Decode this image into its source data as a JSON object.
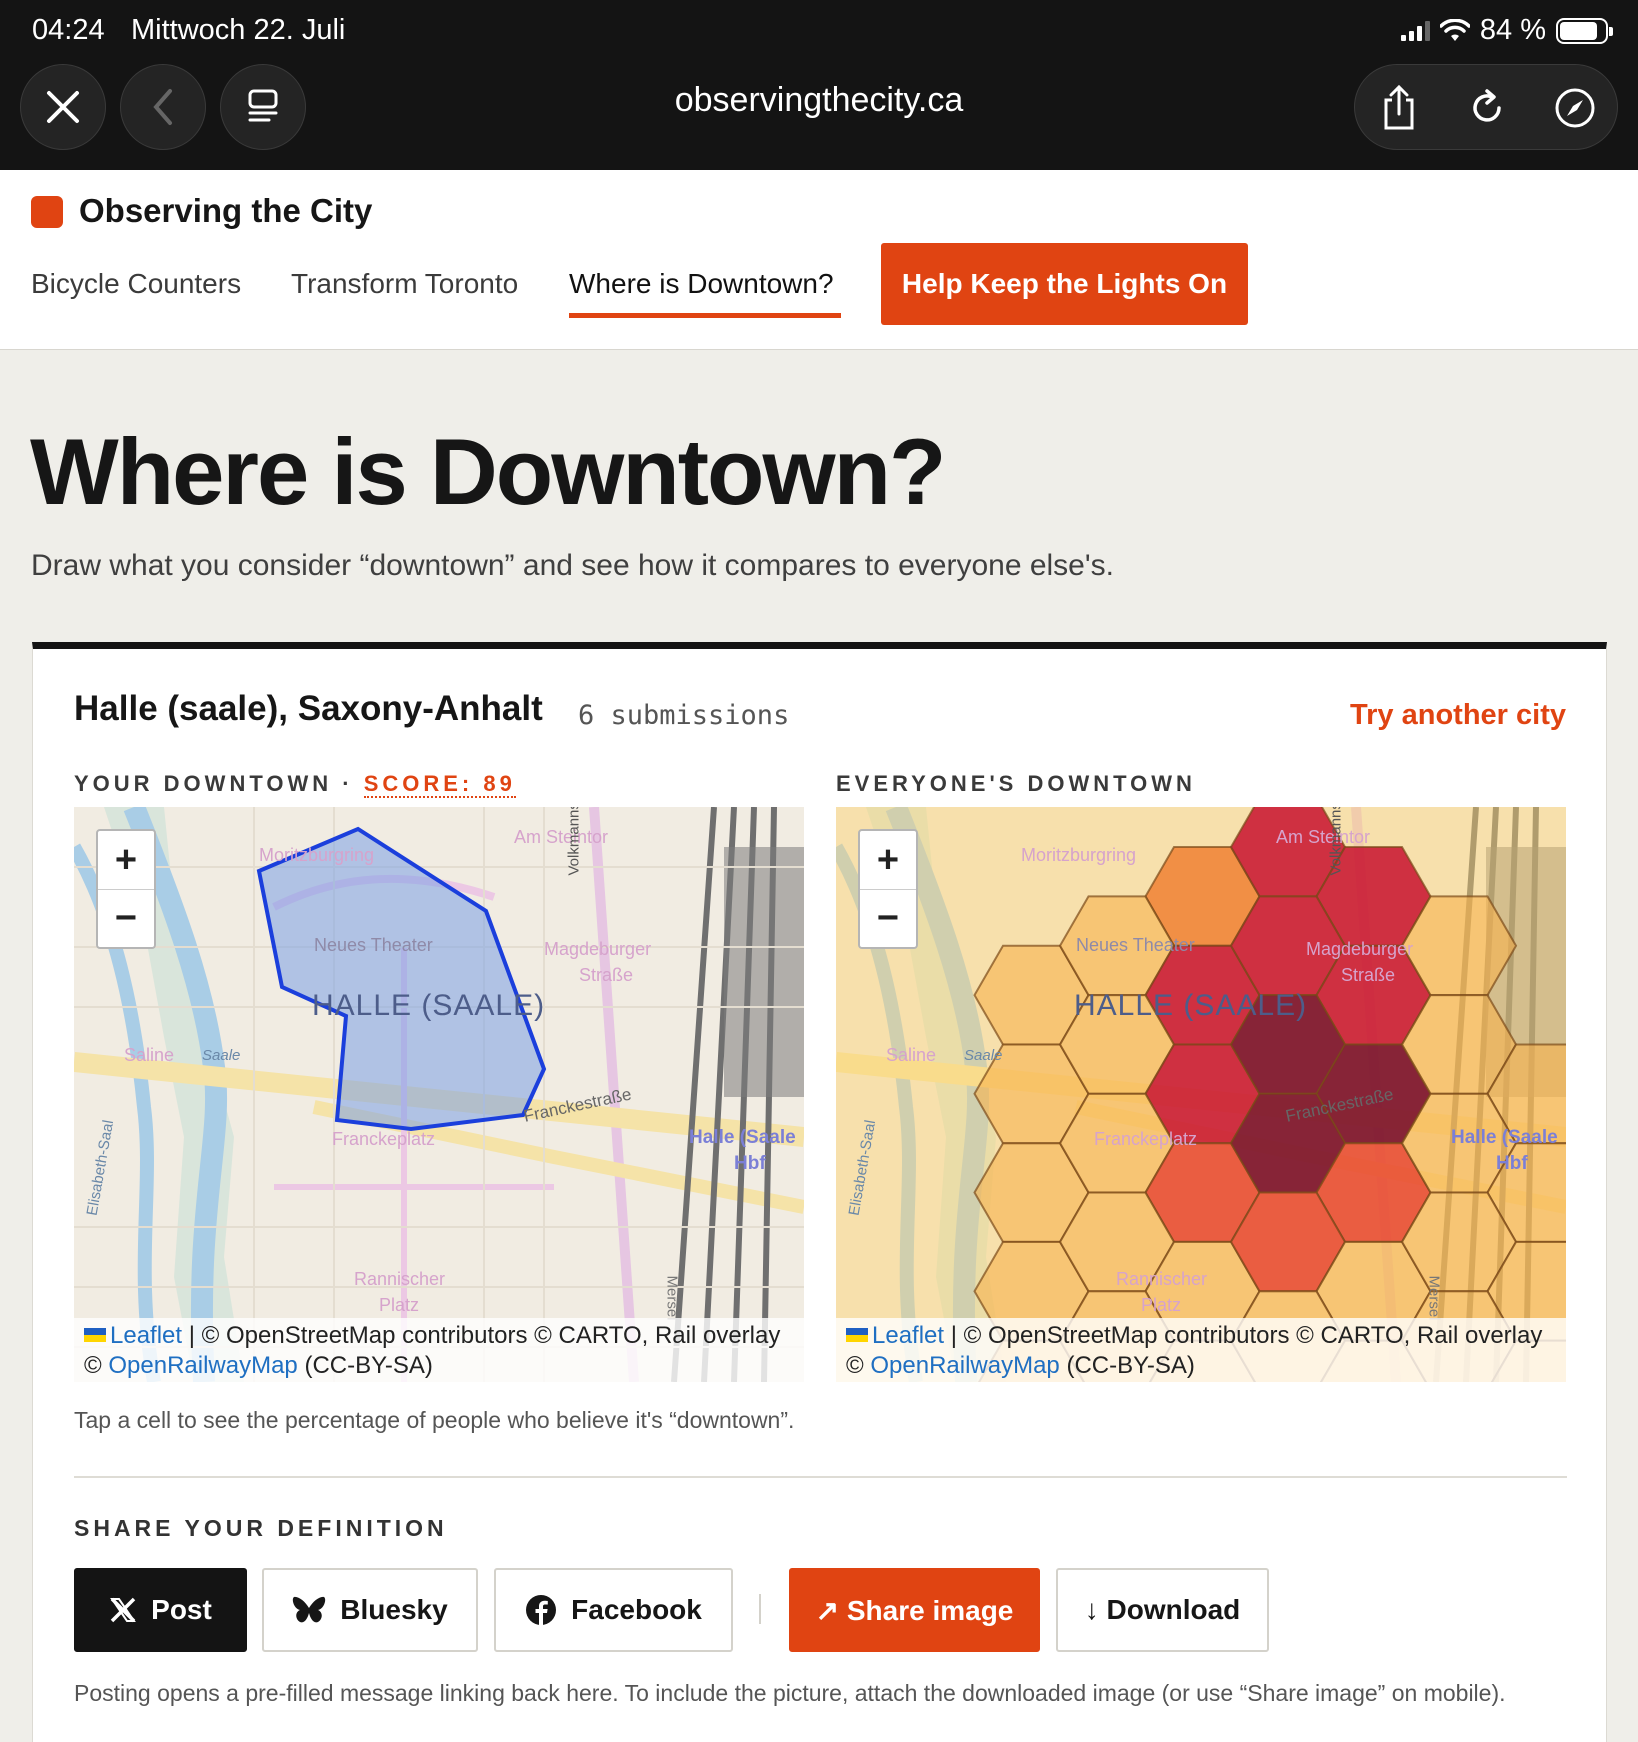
{
  "status_bar": {
    "time": "04:24",
    "date": "Mittwoch 22. Juli",
    "battery": "84 %",
    "battery_level": 0.84
  },
  "browser": {
    "url": "observingthecity.ca",
    "icons": [
      "close-icon",
      "back-icon",
      "reader-icon",
      "share-icon",
      "reload-icon",
      "compass-icon"
    ]
  },
  "site": {
    "logo": "Observing the City",
    "brand_color": "#e04412",
    "nav": [
      "Bicycle Counters",
      "Transform Toronto",
      "Where is Downtown?"
    ],
    "nav_active": "Where is Downtown?",
    "donate": "Help Keep the Lights On"
  },
  "page": {
    "title": "Where is Downtown?",
    "subtitle": "Draw what you consider “downtown” and see how it compares to everyone else's."
  },
  "card": {
    "city": "Halle (saale), Saxony-Anhalt",
    "submissions": "6 submissions",
    "try_another": "Try another city",
    "your_label": "YOUR DOWNTOWN · ",
    "score": "SCORE: 89",
    "everyone_label": "EVERYONE'S DOWNTOWN",
    "tap_note": "Tap a cell to see the percentage of people who believe it's “downtown”.",
    "share_label": "SHARE YOUR DEFINITION",
    "buttons": {
      "post": "Post",
      "bluesky": "Bluesky",
      "facebook": "Facebook",
      "share_image": "↗ Share image",
      "download": "↓ Download"
    },
    "post_note": "Posting opens a pre-filled message linking back here. To include the picture, attach the downloaded image (or use “Share image” on mobile)."
  },
  "map": {
    "zoom_in": "+",
    "zoom_out": "−",
    "city_label": "HALLE (SAALE)",
    "labels": {
      "moritzburgring": "Moritzburgring",
      "am_steintor": "Am Steintor",
      "neues_theater": "Neues Theater",
      "magdeburger_1": "Magdeburger",
      "magdeburger_2": "Straße",
      "saline": "Saline",
      "saale": "Saale",
      "franckeplatz": "Franckeplatz",
      "franckestrasse": "Franckestraße",
      "hbf_1": "Halle (Saale",
      "hbf_2": "Hbf",
      "rannischer_1": "Rannischer",
      "rannischer_2": "Platz",
      "volkmann": "Volkmannstraße",
      "elisabeth": "Elisabeth-Saal",
      "mersel": "Mersel"
    },
    "attribution_leaflet": "Leaflet",
    "attribution_mid": " | © OpenStreetMap contributors © CARTO, Rail overlay",
    "attribution_copy": "© ",
    "attribution_orm": "OpenRailwayMap",
    "attribution_end": " (CC-BY-SA)"
  }
}
